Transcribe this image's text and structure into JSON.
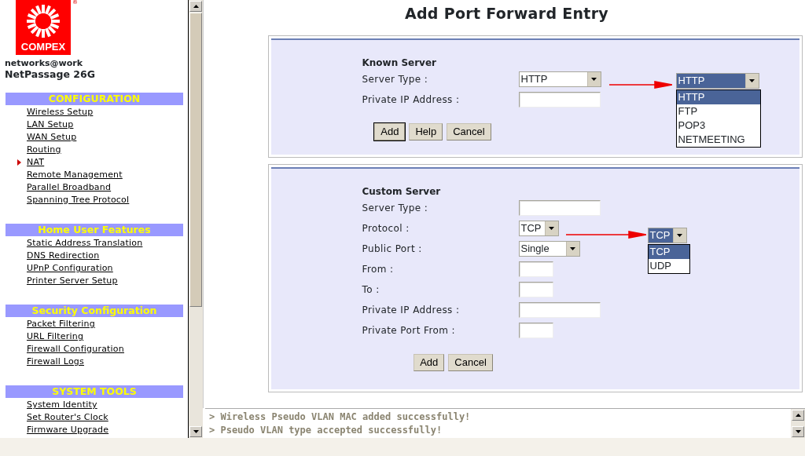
{
  "logo": {
    "brand": "COMPEX",
    "mark": "®",
    "tagline": "networks@work",
    "product": "NetPassage 26G"
  },
  "sidebar": {
    "sections": [
      {
        "title": "CONFIGURATION",
        "items": [
          {
            "label": "Wireless Setup",
            "selected": false
          },
          {
            "label": "LAN Setup",
            "selected": false
          },
          {
            "label": "WAN Setup",
            "selected": false
          },
          {
            "label": "Routing",
            "selected": false
          },
          {
            "label": "NAT",
            "selected": true
          },
          {
            "label": "Remote Management",
            "selected": false
          },
          {
            "label": "Parallel Broadband",
            "selected": false
          },
          {
            "label": "Spanning Tree Protocol",
            "selected": false
          }
        ]
      },
      {
        "title": "Home User Features",
        "items": [
          {
            "label": "Static Address Translation",
            "selected": false
          },
          {
            "label": "DNS Redirection",
            "selected": false
          },
          {
            "label": "UPnP Configuration",
            "selected": false
          },
          {
            "label": "Printer Server Setup",
            "selected": false
          }
        ]
      },
      {
        "title": "Security Configuration",
        "items": [
          {
            "label": "Packet Filtering",
            "selected": false
          },
          {
            "label": "URL Filtering",
            "selected": false
          },
          {
            "label": "Firewall Configuration",
            "selected": false
          },
          {
            "label": "Firewall Logs",
            "selected": false
          }
        ]
      },
      {
        "title": "SYSTEM TOOLS",
        "items": [
          {
            "label": "System Identity",
            "selected": false
          },
          {
            "label": "Set Router's Clock",
            "selected": false
          },
          {
            "label": "Firmware Upgrade",
            "selected": false
          }
        ]
      }
    ]
  },
  "page_title": "Add Port Forward Entry",
  "panels": [
    {
      "title": "Known Server",
      "fields": [
        {
          "label": "Server Type :",
          "kind": "select",
          "value": "HTTP"
        },
        {
          "label": "Private IP Address :",
          "kind": "text"
        }
      ],
      "buttons": [
        {
          "label": "Add",
          "default": true
        },
        {
          "label": "Help",
          "default": false
        },
        {
          "label": "Cancel",
          "default": false
        }
      ],
      "preview": {
        "value": "HTTP",
        "options": [
          {
            "label": "HTTP",
            "selected": true
          },
          {
            "label": "FTP",
            "selected": false
          },
          {
            "label": "POP3",
            "selected": false
          },
          {
            "label": "NETMEETING",
            "selected": false
          }
        ]
      }
    },
    {
      "title": "Custom Server",
      "fields": [
        {
          "label": "Server Type :",
          "kind": "text"
        },
        {
          "label": "Protocol :",
          "kind": "compact_select",
          "value": "TCP"
        },
        {
          "label": "Public Port :",
          "kind": "compact_select",
          "value": "Single"
        },
        {
          "label": "From :",
          "kind": "short_text"
        },
        {
          "label": "To :",
          "kind": "short_text"
        },
        {
          "label": "Private IP Address :",
          "kind": "text"
        },
        {
          "label": "Private Port From :",
          "kind": "short_text"
        }
      ],
      "buttons": [
        {
          "label": "Add",
          "default": false
        },
        {
          "label": "Cancel",
          "default": false
        }
      ],
      "preview": {
        "value": "TCP",
        "options": [
          {
            "label": "TCP",
            "selected": true
          },
          {
            "label": "UDP",
            "selected": false
          }
        ]
      }
    }
  ],
  "log": [
    "> Wireless Pseudo VLAN MAC added successfully!",
    "> Pseudo VLAN type accepted successfully!"
  ]
}
